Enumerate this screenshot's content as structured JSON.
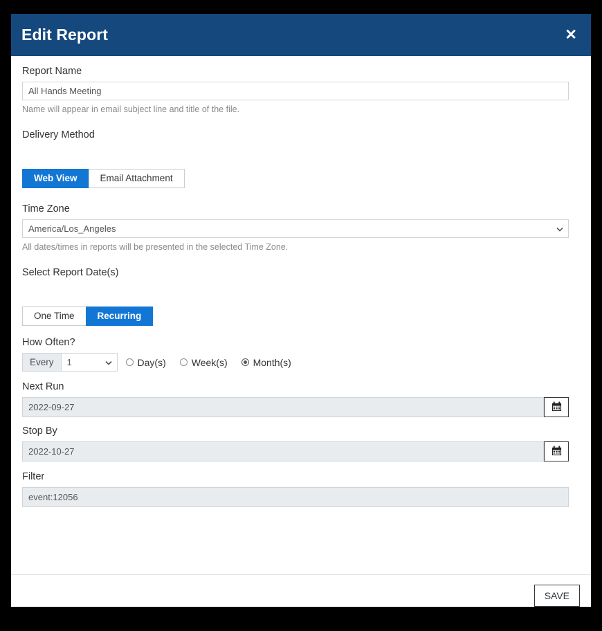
{
  "dialog": {
    "title": "Edit Report",
    "close_icon": "close-icon"
  },
  "report_name": {
    "label": "Report Name",
    "value": "All Hands Meeting",
    "placeholder": "Report Name",
    "help": "Name will appear in email subject line and title of the file."
  },
  "delivery_method": {
    "label": "Delivery Method",
    "options": [
      {
        "label": "Web View",
        "active": true
      },
      {
        "label": "Email Attachment",
        "active": false
      }
    ]
  },
  "time_zone": {
    "label": "Time Zone",
    "selected": "America/Los_Angeles",
    "help": "All dates/times in reports will be presented in the selected Time Zone.",
    "chevron_icon": "chevron-down-icon"
  },
  "report_dates": {
    "label": "Select Report Date(s)",
    "options": [
      {
        "label": "One Time",
        "active": false
      },
      {
        "label": "Recurring",
        "active": true
      }
    ]
  },
  "how_often": {
    "label": "How Often?",
    "addon": "Every",
    "interval_value": "1",
    "chevron_icon": "chevron-down-icon",
    "units": [
      {
        "label": "Day(s)",
        "checked": false
      },
      {
        "label": "Week(s)",
        "checked": false
      },
      {
        "label": "Month(s)",
        "checked": true
      }
    ]
  },
  "next_run": {
    "label": "Next Run",
    "value": "2022-09-27",
    "calendar_icon": "calendar-icon"
  },
  "stop_by": {
    "label": "Stop By",
    "value": "2022-10-27",
    "calendar_icon": "calendar-icon"
  },
  "filter": {
    "label": "Filter",
    "value": "event:12056"
  },
  "footer": {
    "save_label": "SAVE"
  },
  "colors": {
    "header_blue": "#15487d",
    "accent_blue": "#1277d4",
    "disabled_grey": "#e9ecef",
    "border_grey": "#ced4da",
    "page_background": "#000000"
  }
}
